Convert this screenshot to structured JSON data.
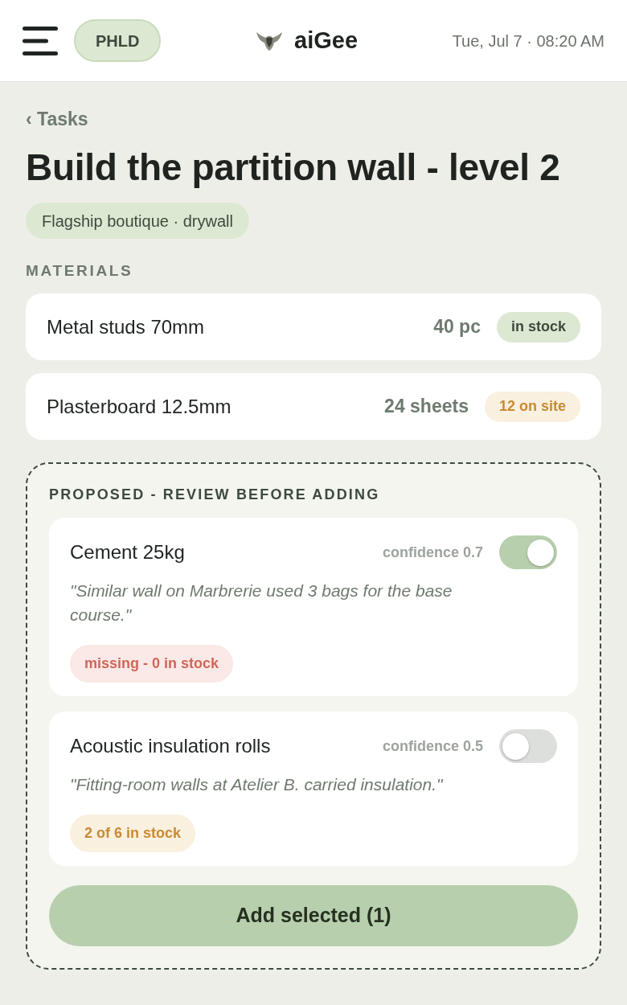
{
  "header": {
    "badge": "PHLD",
    "brand": "aiGee",
    "datetime": "Tue, Jul 7 · 08:20 AM"
  },
  "back_link": "‹ Tasks",
  "title": "Build the partition wall - level 2",
  "tag": "Flagship boutique · drywall",
  "materials": {
    "heading": "MATERIALS",
    "items": [
      {
        "name": "Metal studs 70mm",
        "quantity": "40 pc",
        "status": {
          "label": "in stock",
          "kind": "ok"
        }
      },
      {
        "name": "Plasterboard 12.5mm",
        "quantity": "24 sheets",
        "status": {
          "label": "12 on site",
          "kind": "partial"
        }
      }
    ]
  },
  "proposed": {
    "heading": "PROPOSED - REVIEW BEFORE ADDING",
    "items": [
      {
        "name": "Cement 25kg",
        "confidence": "confidence 0.7",
        "on": true,
        "note": "\"Similar wall on Marbrerie used 3 bags for the base course.\"",
        "status": {
          "label": "missing - 0 in stock",
          "kind": "missing"
        }
      },
      {
        "name": "Acoustic insulation rolls",
        "confidence": "confidence 0.5",
        "on": false,
        "note": "\"Fitting-room walls at Atelier B. carried insulation.\"",
        "status": {
          "label": "2 of 6 in stock",
          "kind": "partial"
        }
      }
    ],
    "button": "Add selected (1)"
  }
}
